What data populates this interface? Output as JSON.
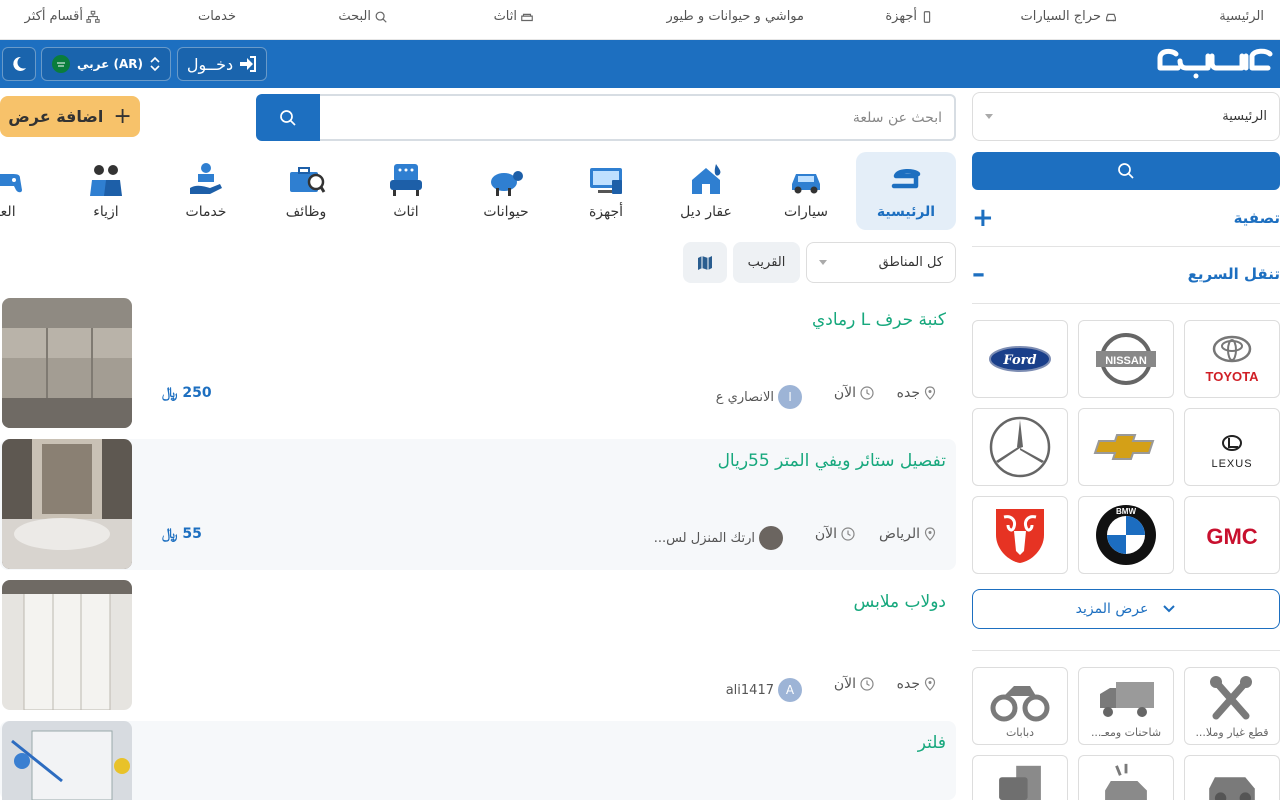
{
  "top_nav": [
    {
      "label": "الرئيسية",
      "icon": ""
    },
    {
      "label": "حراج السيارات",
      "icon": "car-icon"
    },
    {
      "label": "أجهزة",
      "icon": "phone-icon"
    },
    {
      "label": "مواشي و حيوانات و طيور",
      "icon": ""
    },
    {
      "label": "اثاث",
      "icon": "sofa-icon"
    },
    {
      "label": "البحث",
      "icon": "search-icon"
    },
    {
      "label": "خدمات",
      "icon": ""
    },
    {
      "label": "أقسام أكثر",
      "icon": "sitemap-icon"
    }
  ],
  "header": {
    "login_label": "دخــول",
    "language_label": "عربي (AR)",
    "theme_icon": "moon-icon",
    "logo_text": "حراج",
    "bg_color": "#1d6fc0"
  },
  "search": {
    "placeholder": "ابحث عن سلعة",
    "add_label": "اضافة عرض",
    "add_color": "#f7c26a"
  },
  "categories": [
    {
      "label": "الرئيسية",
      "icon": "haraj-logo-icon",
      "active": true
    },
    {
      "label": "سيارات",
      "icon": "car-icon"
    },
    {
      "label": "عقار ديل",
      "icon": "house-icon"
    },
    {
      "label": "أجهزة",
      "icon": "devices-icon"
    },
    {
      "label": "حيوانات",
      "icon": "sheep-icon"
    },
    {
      "label": "اثاث",
      "icon": "sofa-icon"
    },
    {
      "label": "وظائف",
      "icon": "briefcase-icon"
    },
    {
      "label": "خدمات",
      "icon": "service-hand-icon"
    },
    {
      "label": "ازياء",
      "icon": "fashion-icon"
    },
    {
      "label": "العا",
      "icon": "gamepad-icon"
    }
  ],
  "filters": {
    "region_label": "كل المناطق",
    "nearby_label": "القريب",
    "map_icon": "map-icon"
  },
  "listings": [
    {
      "title": "كنبة حرف L رمادي",
      "city": "جده",
      "time": "الآن",
      "user": "الانصاري ع",
      "avatar_letter": "ا",
      "price": "250"
    },
    {
      "title": "تفصيل ستائر ويفي المتر 55ريال",
      "city": "الرياض",
      "time": "الآن",
      "user": "ارتك المنزل لس...",
      "avatar_letter": "",
      "price": "55"
    },
    {
      "title": "دولاب ملابس",
      "city": "جده",
      "time": "الآن",
      "user": "ali1417",
      "avatar_letter": "A",
      "price": ""
    },
    {
      "title": "فلتر",
      "city": "",
      "time": "",
      "user": "",
      "avatar_letter": "",
      "price": ""
    }
  ],
  "sidebar": {
    "select_value": "الرئيسية",
    "filter_label": "تصفية",
    "filter_symbol": "+",
    "quick_label": "تنقل السريع",
    "quick_symbol": "–",
    "brands": [
      {
        "name": "TOYOTA",
        "icon": "toyota-logo"
      },
      {
        "name": "NISSAN",
        "icon": "nissan-logo"
      },
      {
        "name": "Ford",
        "icon": "ford-logo"
      },
      {
        "name": "LEXUS",
        "icon": "lexus-logo"
      },
      {
        "name": "",
        "icon": "chevrolet-logo"
      },
      {
        "name": "",
        "icon": "mercedes-logo"
      },
      {
        "name": "GMC",
        "icon": "gmc-logo"
      },
      {
        "name": "BMW",
        "icon": "bmw-logo"
      },
      {
        "name": "",
        "icon": "dodge-ram-logo"
      }
    ],
    "more_label": "عرض المزيد",
    "tiles": [
      {
        "label": "قطع غيار وملا...",
        "icon": "tools-icon"
      },
      {
        "label": "شاحنات ومعـ...",
        "icon": "truck-icon"
      },
      {
        "label": "دبابات",
        "icon": "atv-icon"
      }
    ]
  }
}
